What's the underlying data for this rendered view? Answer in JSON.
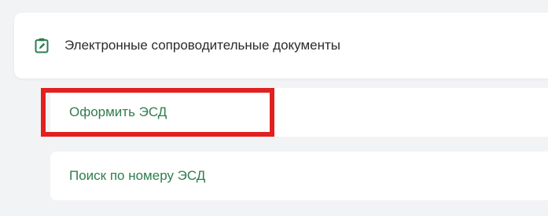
{
  "section": {
    "title": "Электронные сопроводительные документы",
    "icon": "clipboard-edit-icon"
  },
  "menu": {
    "items": [
      {
        "label": "Оформить ЭСД",
        "highlighted": true
      },
      {
        "label": "Поиск по номеру ЭСД",
        "highlighted": false
      }
    ]
  },
  "colors": {
    "accent": "#2e7d4f",
    "highlight": "#e1201f",
    "background": "#f2f3f5"
  }
}
